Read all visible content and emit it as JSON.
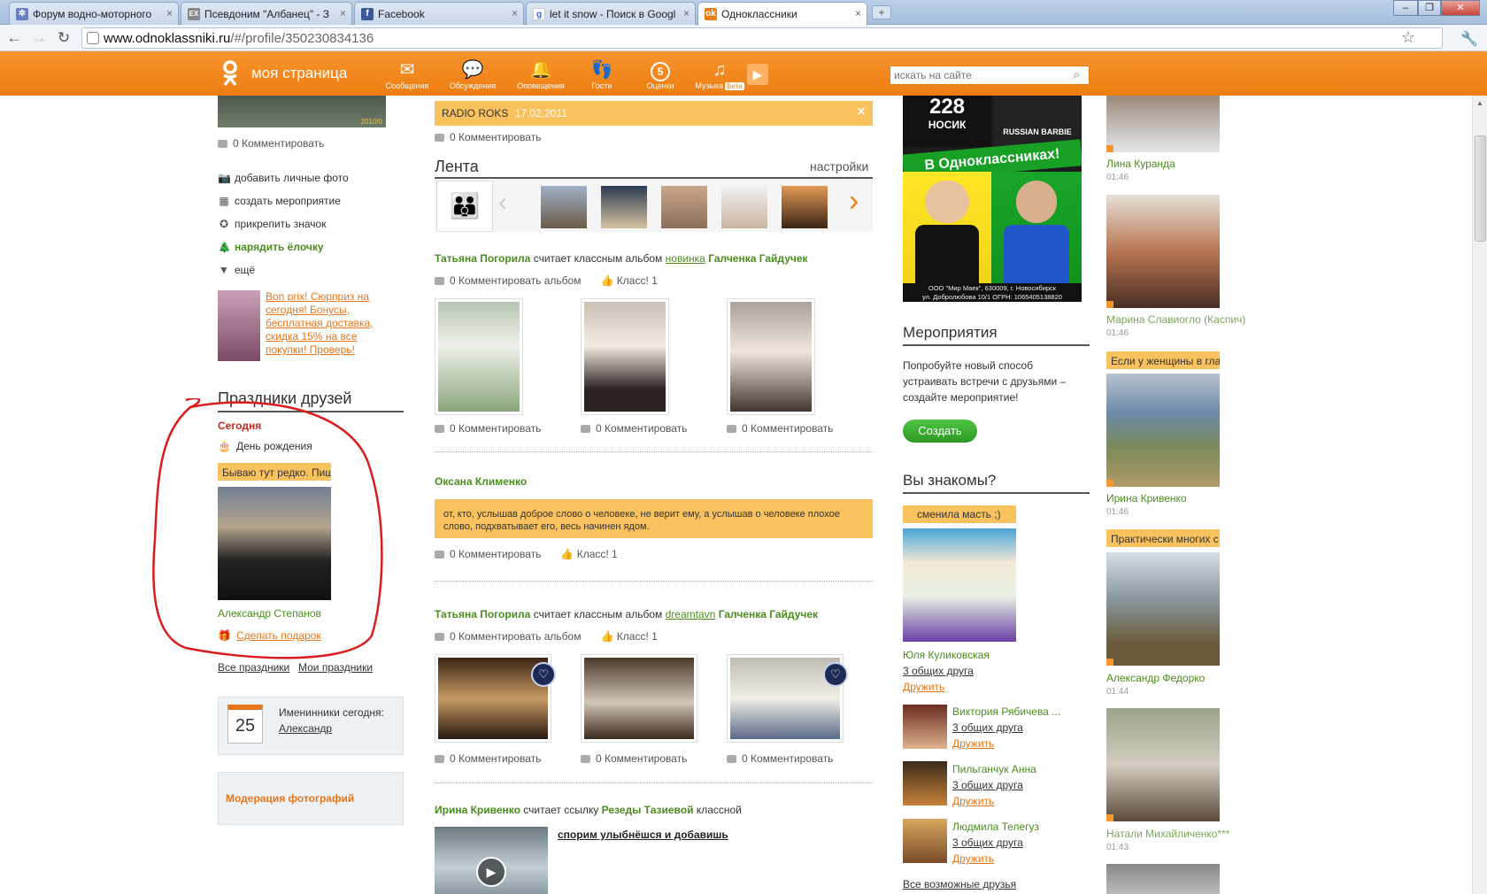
{
  "browser": {
    "tabs": [
      {
        "title": "Форум водно-моторного"
      },
      {
        "title": "Псевдоним \"Албанец\" - З"
      },
      {
        "title": "Facebook"
      },
      {
        "title": "let it snow - Поиск в Googl"
      },
      {
        "title": "Одноклассники"
      }
    ],
    "url_host": "www.odnoklassniki.ru",
    "url_path": "/#/profile/350230834136"
  },
  "header": {
    "my_page": "моя страница",
    "nav": [
      {
        "label": "Сообщения",
        "icon": "envelope-icon"
      },
      {
        "label": "Обсуждения",
        "icon": "discussions-icon"
      },
      {
        "label": "Оповещения",
        "icon": "bell-icon"
      },
      {
        "label": "Гости",
        "icon": "footprints-icon"
      },
      {
        "label": "Оценки",
        "icon": "ratings-icon",
        "badge": "5"
      },
      {
        "label": "Музыка",
        "icon": "music-note-icon",
        "badge": "Бета"
      }
    ],
    "search_placeholder": "искать на сайте"
  },
  "left": {
    "top_photo_date": "2010/0",
    "top_comment": "0 Комментировать",
    "actions": [
      {
        "label": "добавить личные фото",
        "icon": "camera-icon"
      },
      {
        "label": "создать мероприятие",
        "icon": "calendar-icon"
      },
      {
        "label": "прикрепить значок",
        "icon": "badge-icon"
      },
      {
        "label": "нарядить ёлочку",
        "icon": "tree-icon"
      },
      {
        "label": "ещё",
        "icon": "triangle-down-icon"
      }
    ],
    "promo_text": "Bon prix! Сюрприз на сегодня! Бонусы, бесплатная доставка, скидка 15% на все покупки! Проверь!",
    "holidays_title": "Праздники друзей",
    "today": "Сегодня",
    "birthday": "День рождения",
    "status": "Бываю тут редко. Пиш",
    "friend_name": "Александр Степанов",
    "make_gift": "Сделать подарок",
    "all_holidays": "Все праздники",
    "my_holidays": "Мои праздники",
    "nameday_title": "Именинники сегодня:",
    "nameday_name": "Александр",
    "nameday_date": "25",
    "moderation": "Модерация фотографий"
  },
  "center": {
    "radio_title": "RADIO ROKS",
    "radio_date": "17.02.2011",
    "radio_comment": "0 Комментировать",
    "feed_title": "Лента",
    "feed_settings": "настройки",
    "items": [
      {
        "author": "Татьяна Погорила",
        "verb": "считает классным альбом",
        "album": "новинка",
        "owner": "Галченка Гайдучек",
        "album_comment": "0 Комментировать альбом",
        "klass": "Класс! 1",
        "photo_comments": [
          "0 Комментировать",
          "0 Комментировать",
          "0 Комментировать"
        ]
      },
      {
        "author": "Оксана Клименко",
        "quote": "от, кто, услышав доброе слово о человеке, не верит ему, а услышав о человеке плохое слово, подхватывает его, весь начинен ядом.",
        "comment": "0 Комментировать",
        "klass": "Класс! 1"
      },
      {
        "author": "Татьяна Погорила",
        "verb": "считает классным альбом",
        "album": "dreamtavn",
        "owner": "Галченка Гайдучек",
        "album_comment": "0 Комментировать альбом",
        "klass": "Класс! 1",
        "photo_comments": [
          "0 Комментировать",
          "0 Комментировать",
          "0 Комментировать"
        ]
      },
      {
        "author": "Ирина Кривенко",
        "verb": "считает ссылку",
        "owner": "Резеды Тазиевой",
        "tail": "классной",
        "link_title": "спорим улыбнёшся и добавишь"
      }
    ]
  },
  "ad": {
    "top1": "228",
    "top2": "НОСИК",
    "top3": "RUSSIAN BARBIE",
    "banner": "В Одноклассниках!",
    "footer1": "ООО \"Мир Маек\", 630009, г. Новосибирск",
    "footer2": "ул. Добролюбова 10/1 ОГРН: 1065405138820"
  },
  "events": {
    "title": "Мероприятия",
    "text": "Попробуйте новый способ устраивать встречи с друзьями – создайте мероприятие!",
    "button": "Создать"
  },
  "know": {
    "title": "Вы знакомы?",
    "status": "сменила масть ;)",
    "first": {
      "name": "Юля Куликовская",
      "common": "3 общих друга",
      "action": "Дружить"
    },
    "people": [
      {
        "name": "Виктория Рябичева ...",
        "common": "3 общих друга",
        "action": "Дружить"
      },
      {
        "name": "Пильганчук Анна",
        "common": "3 общих друга",
        "action": "Дружить"
      },
      {
        "name": "Людмила Телегуз",
        "common": "3 общих друга",
        "action": "Дружить"
      }
    ],
    "all": "Все возможные друзья"
  },
  "online": [
    {
      "name": "Лина Куранда",
      "time": "01:46"
    },
    {
      "name": "Марина Славиогло (Каспич)",
      "time": "01:46"
    },
    {
      "name": "Ирина Кривенко",
      "time": "01:46",
      "status": "Если у женщины в гла"
    },
    {
      "name": "Александр Федорко",
      "time": "01:44",
      "status": "Практически многих с"
    },
    {
      "name": "Натали Михайличенко***",
      "time": "01:43"
    }
  ]
}
